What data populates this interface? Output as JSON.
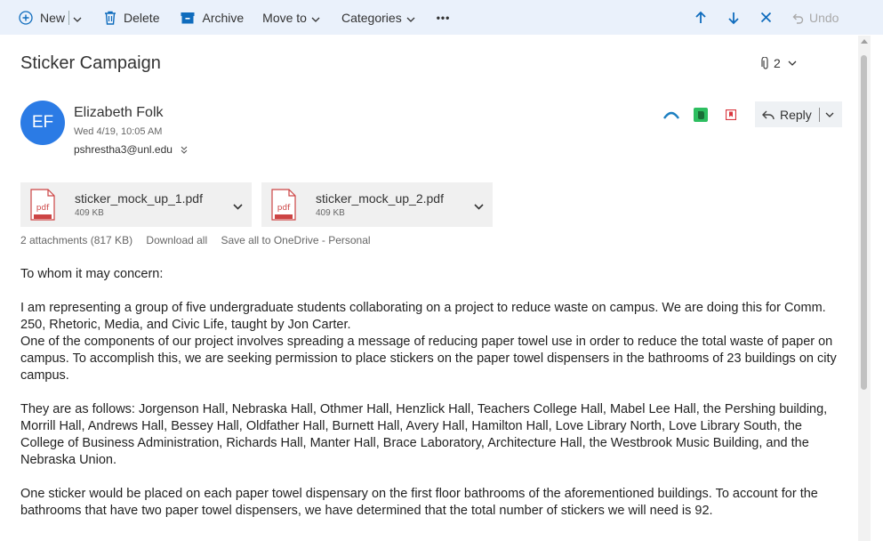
{
  "toolbar": {
    "new_label": "New",
    "delete_label": "Delete",
    "archive_label": "Archive",
    "move_to_label": "Move to",
    "categories_label": "Categories",
    "more_label": "•••",
    "undo_label": "Undo"
  },
  "message": {
    "subject": "Sticker Campaign",
    "attachment_count": "2",
    "sender_initials": "EF",
    "sender_name": "Elizabeth Folk",
    "date": "Wed 4/19, 10:05 AM",
    "to_email": "pshrestha3@unl.edu",
    "reply_label": "Reply"
  },
  "attachments": {
    "items": [
      {
        "name": "sticker_mock_up_1.pdf",
        "size": "409 KB"
      },
      {
        "name": "sticker_mock_up_2.pdf",
        "size": "409 KB"
      }
    ],
    "summary": "2 attachments (817 KB)",
    "download_all": "Download all",
    "save_all": "Save all to OneDrive - Personal"
  },
  "body": {
    "p1": "To whom it may concern:",
    "p2a": "I am representing a group of five undergraduate students collaborating on a project to reduce waste on campus. We are doing this for Comm. 250, Rhetoric, Media, and Civic Life, taught by Jon Carter.",
    "p2b": "One of the components of our project involves spreading a message of reducing paper towel use in order to reduce the total waste of paper on campus. To accomplish this, we are seeking permission to place stickers on the paper towel dispensers in the bathrooms of 23 buildings on city campus.",
    "p3": "They are as follows: Jorgenson Hall, Nebraska Hall, Othmer Hall, Henzlick Hall, Teachers College Hall, Mabel Lee Hall, the Pershing building, Morrill Hall, Andrews Hall, Bessey Hall, Oldfather Hall, Burnett Hall, Avery Hall, Hamilton Hall, Love Library North, Love Library South, the College of Business Administration, Richards Hall, Manter Hall, Brace Laboratory, Architecture Hall, the Westbrook Music Building, and the Nebraska Union.",
    "p4": "One sticker would be placed on each paper towel dispensary on the first floor bathrooms of the aforementioned buildings. To account for the bathrooms that have two paper towel dispensers, we have determined that the total number of stickers we will need is 92."
  },
  "colors": {
    "accent": "#0f6cbd",
    "avatar": "#2b7be5",
    "toolbar_bg": "#eaf1fb"
  }
}
